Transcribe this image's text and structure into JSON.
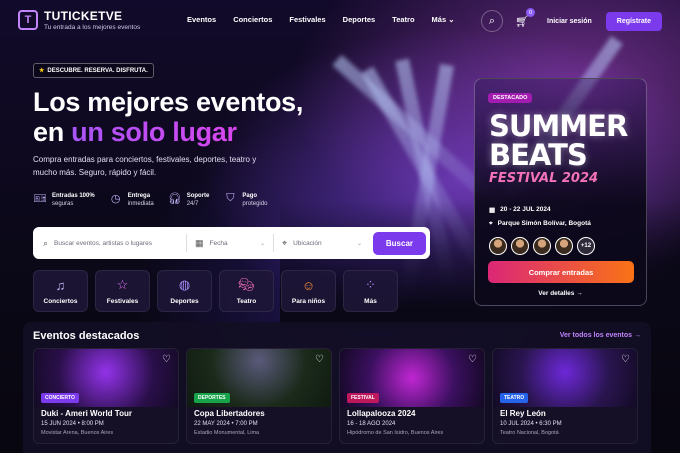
{
  "brand": {
    "name": "TUTICKETVE",
    "tagline": "Tu entrada a los mejores eventos",
    "logo_letter": "T"
  },
  "nav": {
    "items": [
      "Eventos",
      "Conciertos",
      "Festivales",
      "Deportes",
      "Teatro",
      "Más"
    ],
    "cart_count": "0",
    "login": "Iniciar sesión",
    "register": "Regístrate"
  },
  "hero": {
    "pill": "DESCUBRE. RESERVA. DISFRUTA.",
    "title_line1": "Los mejores eventos,",
    "title_en": "en ",
    "title_highlight": "un solo lugar",
    "subtitle": "Compra entradas para conciertos, festivales, deportes, teatro y mucho más. Seguro, rápido y fácil."
  },
  "features": [
    {
      "title": "Entradas 100%",
      "sub": "seguras",
      "icon": "ticket-icon"
    },
    {
      "title": "Entrega",
      "sub": "inmediata",
      "icon": "clock-icon"
    },
    {
      "title": "Soporte",
      "sub": "24/7",
      "icon": "headset-icon"
    },
    {
      "title": "Pago",
      "sub": "protegido",
      "icon": "shield-icon"
    }
  ],
  "search": {
    "placeholder": "Buscar eventos, artistas o lugares",
    "date": "Fecha",
    "location": "Ubicación",
    "button": "Buscar"
  },
  "categories": [
    {
      "label": "Conciertos",
      "icon": "music-note-icon"
    },
    {
      "label": "Festivales",
      "icon": "star-icon"
    },
    {
      "label": "Deportes",
      "icon": "ball-icon"
    },
    {
      "label": "Teatro",
      "icon": "theater-mask-icon"
    },
    {
      "label": "Para niños",
      "icon": "smile-icon"
    },
    {
      "label": "Más",
      "icon": "grid-icon"
    }
  ],
  "featured": {
    "badge": "DESTACADO",
    "line1": "SUMMER",
    "line2": "BEATS",
    "festival": "FESTIVAL 2024",
    "date": "20 - 22 JUL 2024",
    "venue": "Parque Simón Bolívar, Bogotá",
    "more_count": "+12",
    "buy": "Comprar entradas",
    "details": "Ver detalles"
  },
  "events_section": {
    "title": "Eventos destacados",
    "see_all": "Ver todos los eventos"
  },
  "events": [
    {
      "tag": "CONCIERTO",
      "tag_color": "#7c3aed",
      "name": "Duki - Ameri World Tour",
      "date": "15 JUN 2024 • 8:00 PM",
      "venue": "Movistar Arena, Buenos Aires"
    },
    {
      "tag": "DEPORTES",
      "tag_color": "#16a34a",
      "name": "Copa Libertadores",
      "date": "22 MAY 2024 • 7:00 PM",
      "venue": "Estadio Monumental, Lima"
    },
    {
      "tag": "FESTIVAL",
      "tag_color": "#be185d",
      "name": "Lollapalooza 2024",
      "date": "16 - 18 AGO 2024",
      "venue": "Hipódromo de San Isidro, Buenos Aires"
    },
    {
      "tag": "TEATRO",
      "tag_color": "#2563eb",
      "name": "El Rey León",
      "date": "10 JUL 2024 • 6:30 PM",
      "venue": "Teatro Nacional, Bogotá"
    }
  ]
}
